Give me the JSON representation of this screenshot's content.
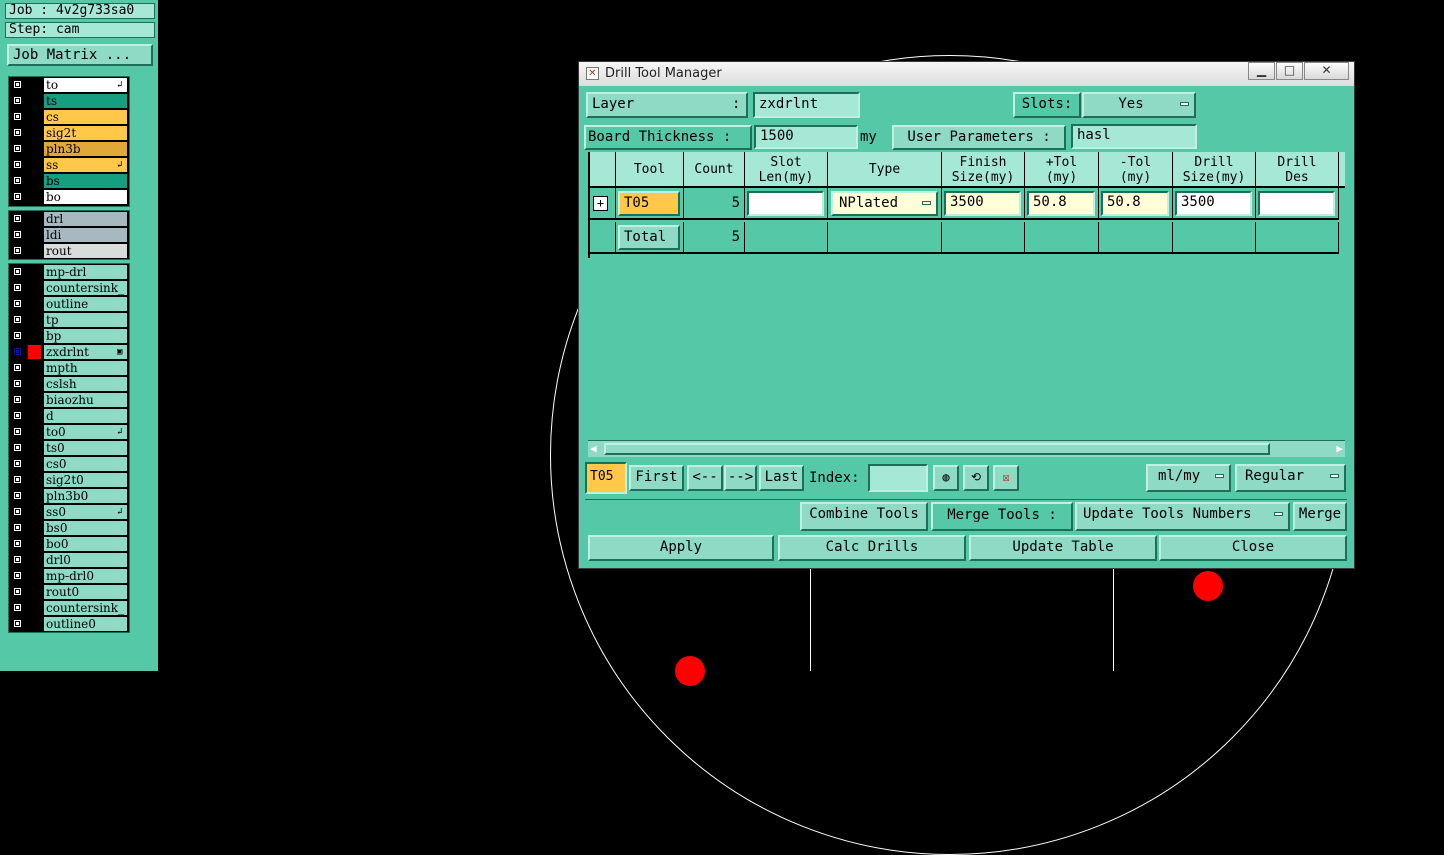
{
  "left_panel": {
    "job": "Job : 4v2g733sa0",
    "step": "Step: cam",
    "job_matrix_label": "Job Matrix ...",
    "layers": [
      {
        "name": "to",
        "color": "#ffffff",
        "mark": "↲"
      },
      {
        "name": "ts",
        "color": "#159e7f",
        "mark": ""
      },
      {
        "name": "cs",
        "color": "#ffc84a",
        "mark": ""
      },
      {
        "name": "sig2t",
        "color": "#ffc84a",
        "mark": ""
      },
      {
        "name": "pln3b",
        "color": "#e0a838",
        "mark": ""
      },
      {
        "name": "ss",
        "color": "#ffc84a",
        "mark": "↲"
      },
      {
        "name": "bs",
        "color": "#159e7f",
        "mark": ""
      },
      {
        "name": "bo",
        "color": "#ffffff",
        "mark": ""
      },
      {
        "name": "drl",
        "color": "#a8b8c0",
        "mark": ""
      },
      {
        "name": "ldi",
        "color": "#a8b8c0",
        "mark": ""
      },
      {
        "name": "rout",
        "color": "#d8dcdc",
        "mark": ""
      },
      {
        "name": "mp-drl",
        "color": "#8edac4",
        "mark": ""
      },
      {
        "name": "countersink_",
        "color": "#8edac4",
        "mark": ""
      },
      {
        "name": "outline",
        "color": "#8edac4",
        "mark": ""
      },
      {
        "name": "tp",
        "color": "#8edac4",
        "mark": ""
      },
      {
        "name": "bp",
        "color": "#8edac4",
        "mark": ""
      },
      {
        "name": "zxdrlnt",
        "color": "#8edac4",
        "mark": "▣"
      },
      {
        "name": "mpth",
        "color": "#8edac4",
        "mark": ""
      },
      {
        "name": "cslsh",
        "color": "#8edac4",
        "mark": ""
      },
      {
        "name": "biaozhu",
        "color": "#8edac4",
        "mark": ""
      },
      {
        "name": "d",
        "color": "#8edac4",
        "mark": ""
      },
      {
        "name": "to0",
        "color": "#8edac4",
        "mark": "↲"
      },
      {
        "name": "ts0",
        "color": "#8edac4",
        "mark": ""
      },
      {
        "name": "cs0",
        "color": "#8edac4",
        "mark": ""
      },
      {
        "name": "sig2t0",
        "color": "#8edac4",
        "mark": ""
      },
      {
        "name": "pln3b0",
        "color": "#8edac4",
        "mark": ""
      },
      {
        "name": "ss0",
        "color": "#8edac4",
        "mark": "↲"
      },
      {
        "name": "bs0",
        "color": "#8edac4",
        "mark": ""
      },
      {
        "name": "bo0",
        "color": "#8edac4",
        "mark": ""
      },
      {
        "name": "drl0",
        "color": "#8edac4",
        "mark": ""
      },
      {
        "name": "mp-drl0",
        "color": "#8edac4",
        "mark": ""
      },
      {
        "name": "rout0",
        "color": "#8edac4",
        "mark": ""
      },
      {
        "name": "countersink_",
        "color": "#8edac4",
        "mark": ""
      },
      {
        "name": "outline0",
        "color": "#8edac4",
        "mark": ""
      }
    ]
  },
  "dialog": {
    "title": "Drill Tool Manager",
    "layer_label": "Layer",
    "layer_colon": ":",
    "layer_value": "zxdrlnt",
    "slots_label": "Slots:",
    "slots_value": "Yes",
    "board_thickness_label": "Board Thickness :",
    "board_thickness_value": "1500",
    "board_thickness_unit": "my",
    "user_params_label": "User Parameters :",
    "user_params_value": "hasl",
    "table": {
      "headers": [
        "Tool",
        "Count",
        "Slot\nLen(my)",
        "Type",
        "Finish\nSize(my)",
        "+Tol\n(my)",
        "-Tol\n(my)",
        "Drill\nSize(my)",
        "Drill\nDes"
      ],
      "row": {
        "tool": "T05",
        "count": "5",
        "slot_len": "",
        "type": "NPlated",
        "finish_size": "3500",
        "plus_tol": "50.8",
        "minus_tol": "50.8",
        "drill_size": "3500",
        "drill_des": ""
      },
      "total": {
        "label": "Total",
        "count": "5"
      }
    },
    "nav": {
      "current_tool": "T05",
      "first": "First",
      "prev": "<--",
      "next": "-->",
      "last": "Last",
      "index_label": "Index:",
      "index_value": "",
      "units": "ml/my",
      "mode": "Regular"
    },
    "actions": {
      "combine": "Combine Tools",
      "merge_label": "Merge Tools :",
      "merge_option": "Update Tools Numbers",
      "merge": "Merge"
    },
    "bottom": {
      "apply": "Apply",
      "calc": "Calc Drills",
      "update": "Update Table",
      "close": "Close"
    }
  }
}
